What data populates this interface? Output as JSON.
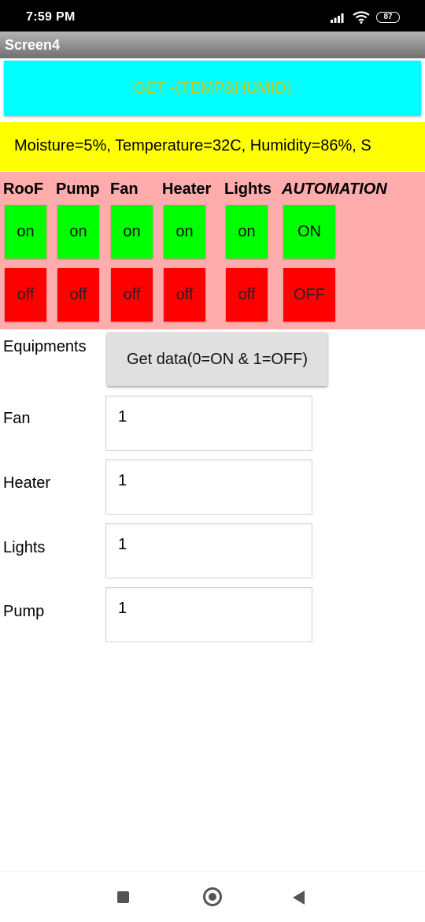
{
  "status_bar": {
    "time": "7:59 PM",
    "battery": "87",
    "icons": [
      "signal-icon",
      "wifi-icon",
      "battery-icon"
    ]
  },
  "app_bar": {
    "title": "Screen4"
  },
  "get_button": {
    "label": "GET -(TEMP&HUMID)"
  },
  "sensor_readout": {
    "text": "Moisture=5%, Temperature=32C, Humidity=86%, S"
  },
  "controls": {
    "headers": [
      "RooF",
      "Pump",
      "Fan",
      "Heater",
      "Lights",
      "AUTOMATION"
    ],
    "on_labels": [
      "on",
      "on",
      "on",
      "on",
      "on",
      "ON"
    ],
    "off_labels": [
      "off",
      "off",
      "off",
      "off",
      "off",
      "OFF"
    ]
  },
  "equipments": {
    "label": "Equipments",
    "button_label": "Get data(0=ON & 1=OFF)",
    "rows": [
      {
        "label": "Fan",
        "value": "1"
      },
      {
        "label": "Heater",
        "value": "1"
      },
      {
        "label": "Lights",
        "value": "1"
      },
      {
        "label": "Pump",
        "value": "1"
      }
    ]
  },
  "colors": {
    "get_button_bg": "#00ffff",
    "sensor_strip_bg": "#ffff00",
    "control_panel_bg": "#ffacac",
    "on_button": "#00ff00",
    "off_button": "#ff0000"
  },
  "nav_bar": {
    "icons": [
      "recent-apps-icon",
      "home-icon",
      "back-icon"
    ]
  }
}
